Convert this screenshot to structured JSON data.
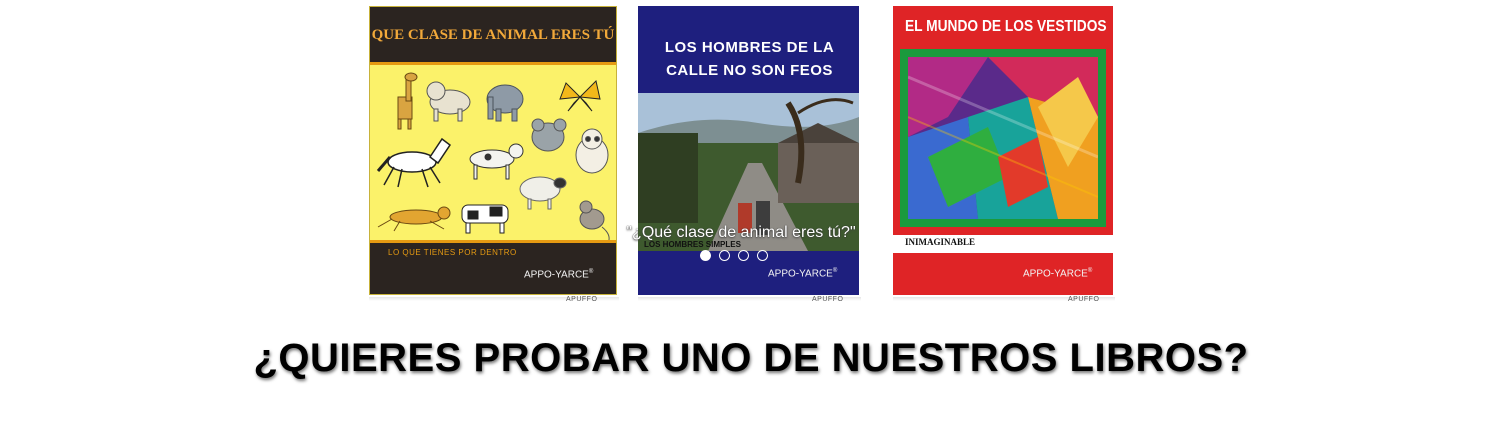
{
  "carousel": {
    "books": [
      {
        "title": "QUE CLASE DE ANIMAL ERES TÚ",
        "subtitle": "LO QUE TIENES POR DENTRO",
        "publisher": "APPO-YARCE",
        "colors": {
          "background": "#fbf26a",
          "band": "#2b2420",
          "title": "#f2a93a",
          "accent": "#e59a12"
        }
      },
      {
        "title": "LOS HOMBRES DE LA CALLE NO SON FEOS",
        "subtitle": "LOS HOMBRES SIMPLES",
        "publisher": "APPO-YARCE",
        "colors": {
          "background": "#1e1f7e",
          "title": "#ffffff"
        }
      },
      {
        "title": "EL MUNDO DE LOS VESTIDOS",
        "subtitle": "INIMAGINABLE",
        "publisher": "APPO-YARCE",
        "colors": {
          "background": "#df2426",
          "frame": "#1a9a3d",
          "title": "#ffffff"
        }
      }
    ],
    "caption": "\"¿Qué clase de animal eres tú?\"",
    "dots": {
      "count": 4,
      "active_index": 0
    },
    "edge_label": "APUFFO"
  },
  "headline": "¿QUIERES PROBAR UNO DE NUESTROS LIBROS?"
}
